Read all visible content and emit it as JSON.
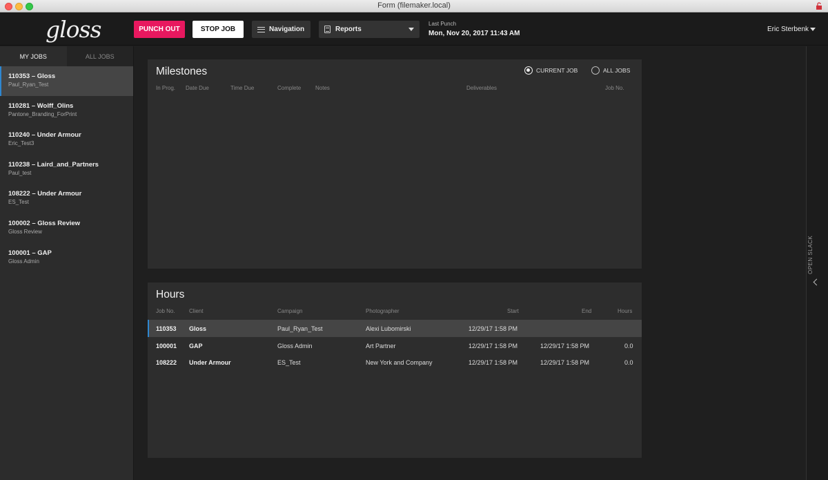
{
  "window": {
    "title": "Form (filemaker.local)"
  },
  "toolbar": {
    "logo": "gloss",
    "punch_out": "PUNCH OUT",
    "stop_job": "STOP JOB",
    "navigation": "Navigation",
    "reports": "Reports",
    "last_punch_label": "Last Punch",
    "last_punch_value": "Mon, Nov 20, 2017 11:43 AM",
    "user": "Eric Sterbenk"
  },
  "sidebar": {
    "tabs": [
      "MY JOBS",
      "ALL JOBS"
    ],
    "active_tab": "MY JOBS",
    "jobs": [
      {
        "title": "110353 – Gloss",
        "sub": "Paul_Ryan_Test",
        "selected": true
      },
      {
        "title": "110281 – Wolff_Olins",
        "sub": "Pantone_Branding_ForPrint"
      },
      {
        "title": "110240 – Under Armour",
        "sub": "Eric_Test3"
      },
      {
        "title": "110238 – Laird_and_Partners",
        "sub": "Paul_test"
      },
      {
        "title": "108222 – Under Armour",
        "sub": "ES_Test"
      },
      {
        "title": "100002 – Gloss Review",
        "sub": "Gloss Review"
      },
      {
        "title": "100001 – GAP",
        "sub": "Gloss Admin"
      }
    ]
  },
  "milestones": {
    "title": "Milestones",
    "radio_current": "CURRENT JOB",
    "radio_all": "ALL JOBS",
    "selected_radio": "CURRENT JOB",
    "columns": [
      "In Prog.",
      "Date Due",
      "Time Due",
      "Complete",
      "Notes",
      "Deliverables",
      "Job No."
    ]
  },
  "hours": {
    "title": "Hours",
    "columns": [
      "Job No.",
      "Client",
      "Campaign",
      "Photographer",
      "Start",
      "End",
      "Hours"
    ],
    "rows": [
      {
        "job": "110353",
        "client": "Gloss",
        "campaign": "Paul_Ryan_Test",
        "photographer": "Alexi Lubomirski",
        "start": "12/29/17 1:58 PM",
        "end": "",
        "hours": ""
      },
      {
        "job": "100001",
        "client": "GAP",
        "campaign": "Gloss Admin",
        "photographer": "Art Partner",
        "start": "12/29/17 1:58 PM",
        "end": "12/29/17 1:58 PM",
        "hours": "0.0"
      },
      {
        "job": "108222",
        "client": "Under Armour",
        "campaign": "ES_Test",
        "photographer": "New York and Company",
        "start": "12/29/17 1:58 PM",
        "end": "12/29/17 1:58 PM",
        "hours": "0.0"
      }
    ]
  },
  "slack": {
    "label": "OPEN SLACK"
  },
  "colors": {
    "accent_pink": "#e8185f",
    "selection_blue": "#2e87d1"
  }
}
